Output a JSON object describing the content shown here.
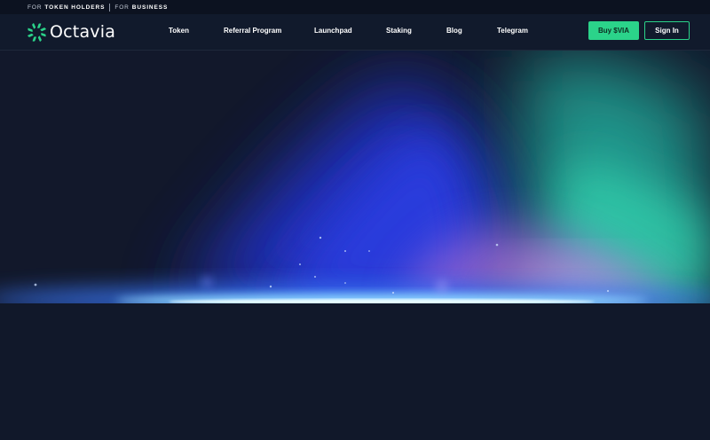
{
  "topbar": {
    "group1_prefix": "FOR",
    "group1_strong": "TOKEN HOLDERS",
    "group2_prefix": "FOR",
    "group2_strong": "BUSINESS"
  },
  "brand": {
    "name": "Octavia",
    "icon": "octavia-logo-icon",
    "color": "#2bd38a"
  },
  "nav": {
    "items": [
      {
        "label": "Token"
      },
      {
        "label": "Referral Program"
      },
      {
        "label": "Launchpad"
      },
      {
        "label": "Staking"
      },
      {
        "label": "Blog"
      },
      {
        "label": "Telegram"
      }
    ]
  },
  "actions": {
    "buy_label": "Buy $VIA",
    "signin_label": "Sign In"
  },
  "colors": {
    "background": "#11182a",
    "accent": "#2bd38a",
    "aurora_blue": "#2a3ad8",
    "aurora_teal": "#2fd4a8",
    "aurora_violet": "#9a6ad8"
  }
}
